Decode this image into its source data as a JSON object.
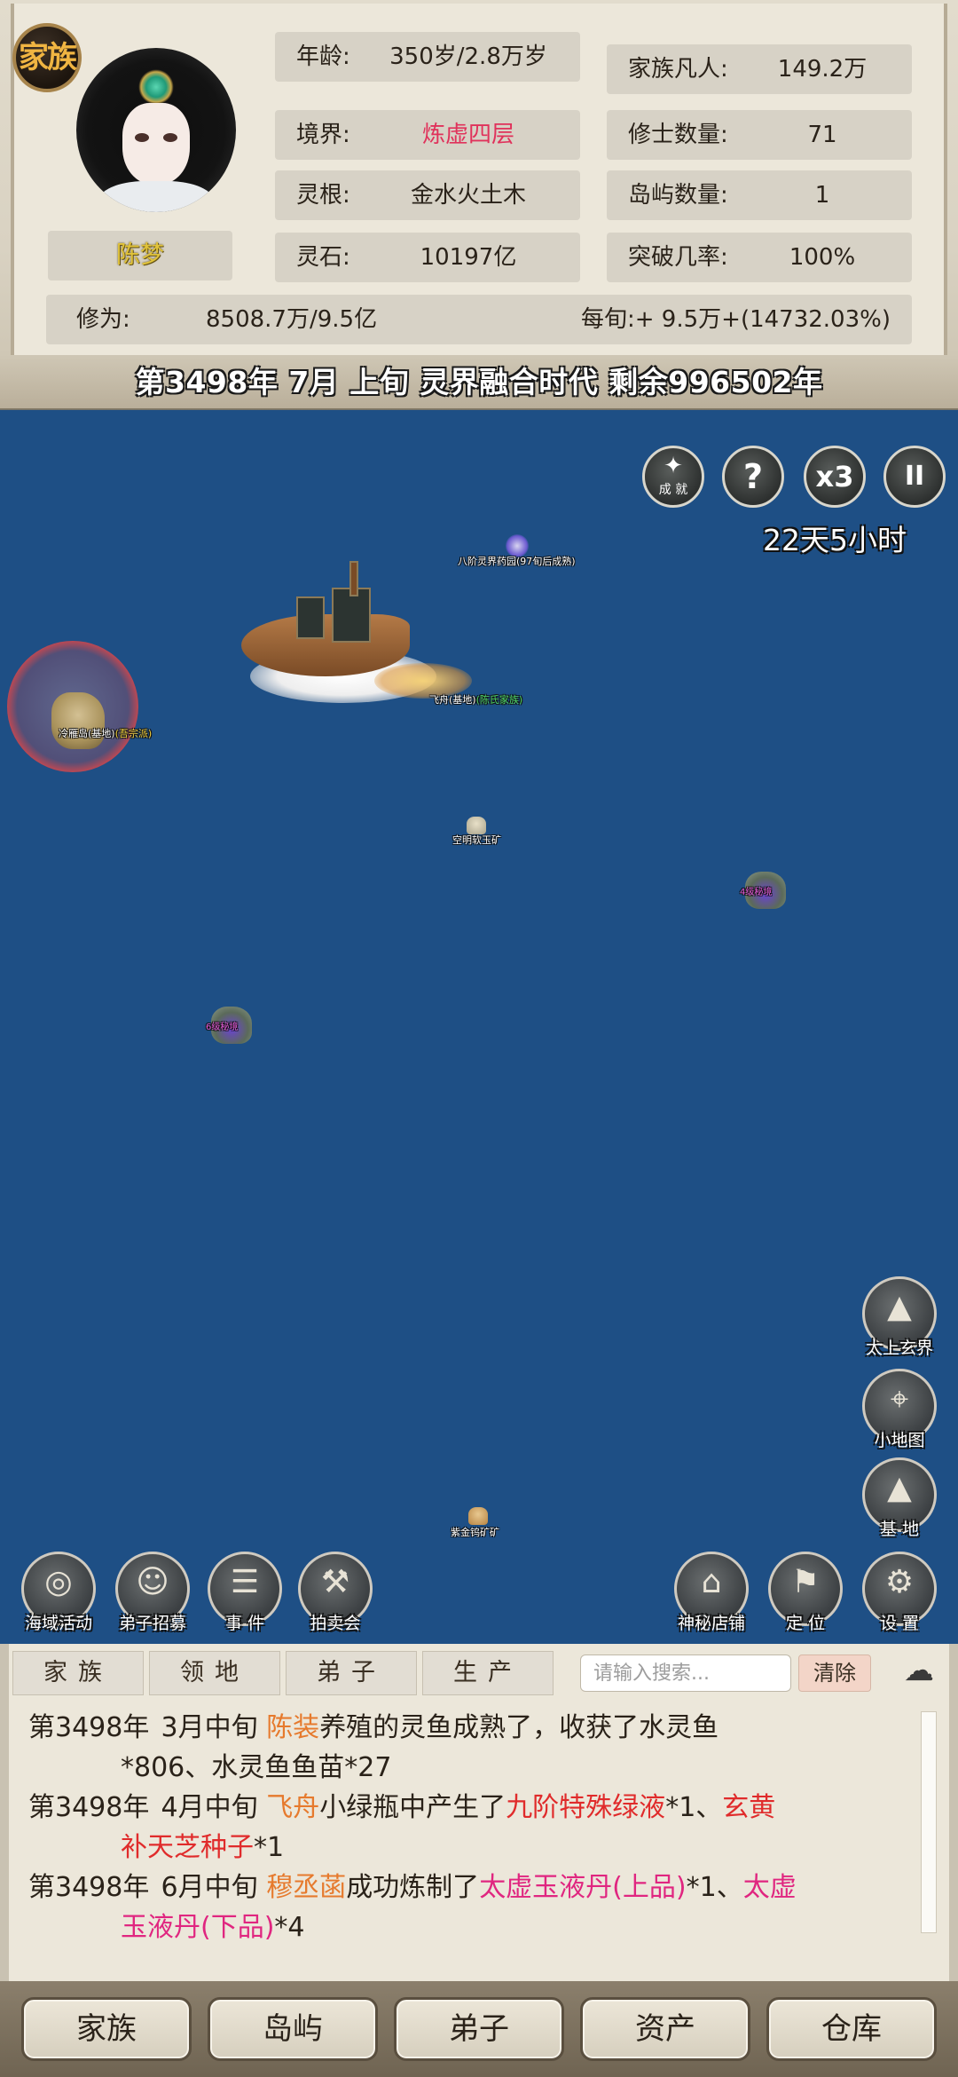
{
  "header": {
    "family_badge": "家族",
    "character_name": "陈梦",
    "stats_left": [
      {
        "label": "年龄:",
        "value": "350岁/2.8万岁"
      },
      {
        "label": "境界:",
        "value": "炼虚四层",
        "color": "#e0325b"
      },
      {
        "label": "灵根:",
        "value": "金水火土木"
      },
      {
        "label": "灵石:",
        "value": "10197亿"
      }
    ],
    "stats_right": [
      {
        "label": "家族凡人:",
        "value": "149.2万"
      },
      {
        "label": "修士数量:",
        "value": "71"
      },
      {
        "label": "岛屿数量:",
        "value": "1"
      },
      {
        "label": "突破几率:",
        "value": "100%"
      }
    ],
    "cultivation": {
      "label": "修为:",
      "value": "8508.7万/9.5亿",
      "rate": "每旬:+ 9.5万+(14732.03%)"
    }
  },
  "time_banner": "第3498年 7月 上旬  灵界融合时代 剩余996502年",
  "map": {
    "top_buttons": [
      {
        "name": "achievement-button",
        "glyph": "✦",
        "label": "成  就"
      },
      {
        "name": "help-button",
        "glyph": "?",
        "label": ""
      },
      {
        "name": "speed-button",
        "glyph": "x3",
        "label": ""
      },
      {
        "name": "pause-button",
        "glyph": "II",
        "label": ""
      }
    ],
    "timer": "22天5小时",
    "island_label": "冷雁岛(基地)",
    "island_tag": "(吾宗派)",
    "spirit_garden_label": "八阶灵界药园(97旬后成熟)",
    "airship_label": "飞舟(基地)",
    "airship_tag": "(陈氏家族)",
    "mine1_label": "空明软玉矿",
    "mine2_label": "紫金钨矿矿",
    "secret1_label": "4级秘境",
    "secret2_label": "6级秘境",
    "left_actions": [
      "海域活动",
      "弟子招募",
      "事 件",
      "拍卖会"
    ],
    "right_actions": [
      "神秘店铺",
      "定 位",
      "设 置"
    ],
    "side_buttons": [
      "太上玄界",
      "小地图",
      "基 地"
    ]
  },
  "log": {
    "tabs": [
      "家族",
      "领地",
      "弟子",
      "生产"
    ],
    "search_placeholder": "请输入搜索...",
    "clear_label": "清除",
    "entries": [
      {
        "year": "第3498年",
        "date": "3月中旬",
        "who": "陈装",
        "text": "养殖的灵鱼成熟了，收获了水灵鱼",
        "cont": "*806、水灵鱼鱼苗*27"
      },
      {
        "year": "第3498年",
        "date": "4月中旬",
        "who": "飞舟",
        "text": "小绿瓶中产生了",
        "item1": "九阶特殊绿液",
        "mid": "*1、",
        "item2a": "玄黄",
        "item2b": "补天芝种子",
        "end": "*1"
      },
      {
        "year": "第3498年",
        "date": "6月中旬",
        "who": "穆丞菡",
        "text": "成功炼制了",
        "item1": "太虚玉液丹(上品)",
        "mid": "*1、",
        "item2a": "太虚",
        "item2b": "玉液丹(下品)",
        "end": "*4"
      }
    ]
  },
  "bottom_nav": [
    "家族",
    "岛屿",
    "弟子",
    "资产",
    "仓库"
  ]
}
